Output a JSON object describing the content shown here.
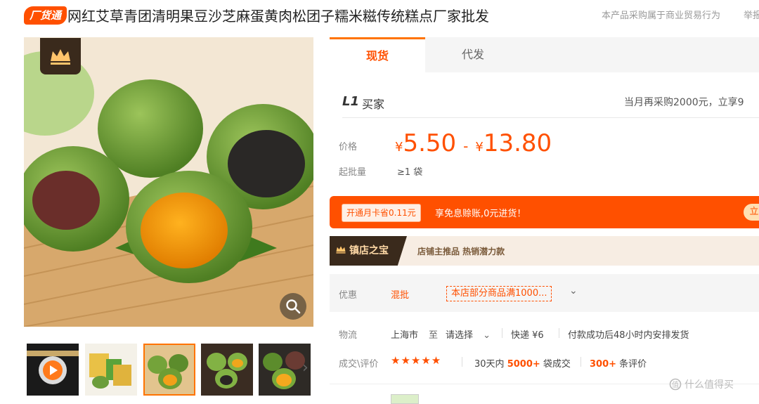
{
  "header": {
    "badge": "厂货通",
    "title": "网红艾草青团清明果豆沙芝麻蛋黄肉松团子糯米糍传统糕点厂家批发",
    "notice": "本产品采购属于商业贸易行为",
    "report": "举报"
  },
  "gallery": {
    "main_alt": "青团",
    "thumbs": [
      "video",
      "package",
      "green-rice-balls",
      "sesame-balls",
      "yolk-balls"
    ],
    "selected_index": 2
  },
  "tabs": [
    {
      "label": "现货",
      "active": true
    },
    {
      "label": "代发",
      "active": false
    }
  ],
  "buyer": {
    "level": "L1",
    "label": "买家",
    "promo": "当月再采购2000元，立享9"
  },
  "price": {
    "label": "价格",
    "currency": "¥",
    "min": "5.50",
    "dash": "-",
    "max": "13.80"
  },
  "moq": {
    "label": "起批量",
    "value": "≥1 袋"
  },
  "card": {
    "pill": "开通月卡省0.11元",
    "text": "享免息赊账,0元进货！",
    "button": "立"
  },
  "treasure": {
    "tag": "镇店之宝",
    "text": "店铺主推品  热销潜力款"
  },
  "promo": {
    "label": "优惠",
    "mix": "混批",
    "tag": "本店部分商品满1000..."
  },
  "shipping": {
    "label": "物流",
    "from": "上海市",
    "to": "至",
    "select": "请选择",
    "fee": "快递 ¥6",
    "time": "付款成功后48小时内安排发货"
  },
  "reviews": {
    "label": "成交\\评价",
    "stars": "★★★★★",
    "sold_prefix": "30天内",
    "sold_count": "5000+",
    "sold_suffix": "袋成交",
    "review_count": "300+",
    "review_suffix": "条评价"
  },
  "watermark": "什么值得买",
  "colors": {
    "accent": "#ff5000",
    "tab_accent": "#ff7300",
    "dark_brown": "#3a2a1c"
  }
}
